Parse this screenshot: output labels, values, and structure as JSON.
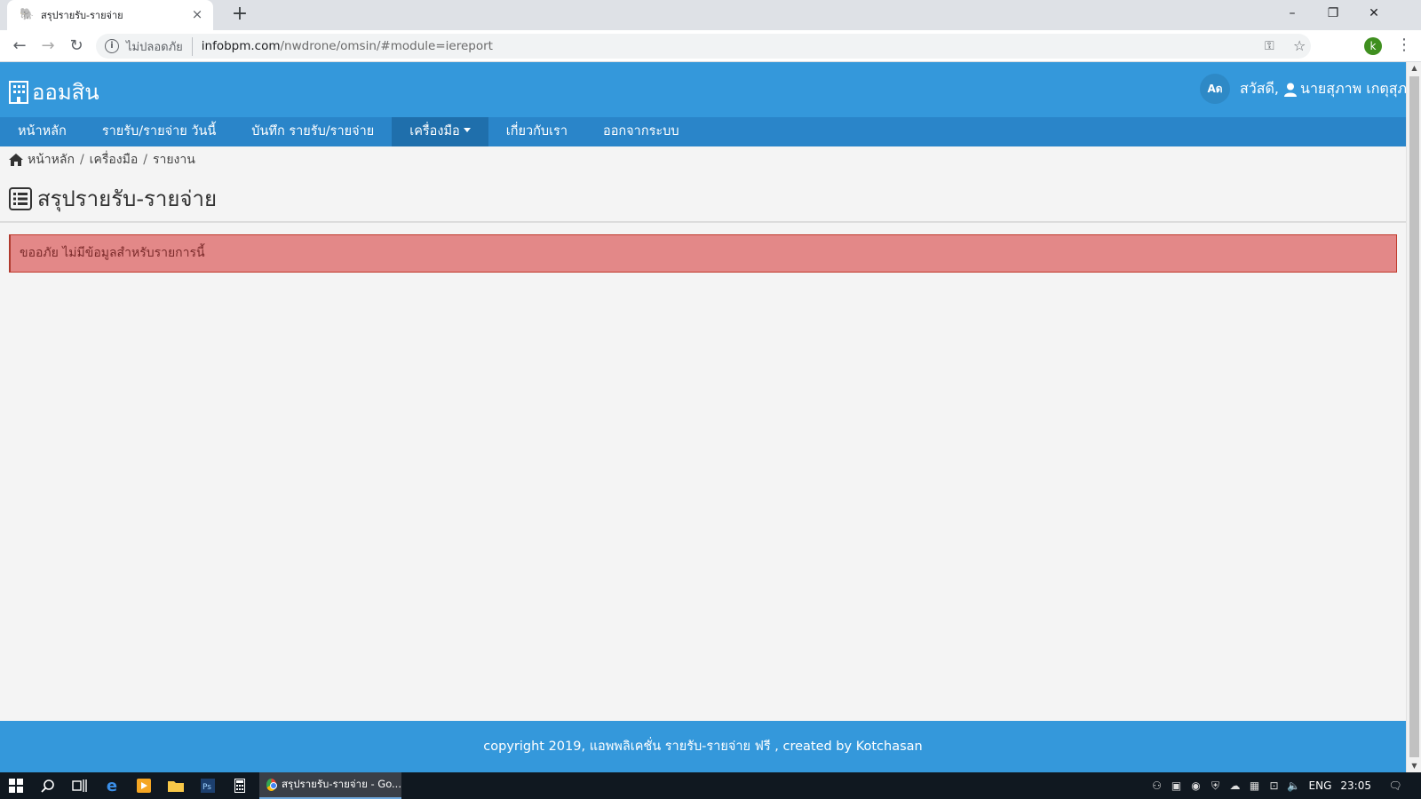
{
  "browser": {
    "tab_title": "สรุปรายรับ-รายจ่าย",
    "security_label": "ไม่ปลอดภัย",
    "url_host": "infobpm.com",
    "url_path": "/nwdrone/omsin/#module=iereport",
    "profile_initial": "k"
  },
  "header": {
    "logo_text": "ออมสิน",
    "lang_button": "Aด",
    "greeting": "สวัสดี,",
    "user_name": "นายสุภาพ เกตุสุภะ"
  },
  "nav": {
    "items": [
      {
        "label": "หน้าหลัก"
      },
      {
        "label": "รายรับ/รายจ่าย วันนี้"
      },
      {
        "label": "บันทึก รายรับ/รายจ่าย"
      },
      {
        "label": "เครื่องมือ"
      },
      {
        "label": "เกี่ยวกับเรา"
      },
      {
        "label": "ออกจากระบบ"
      }
    ]
  },
  "breadcrumb": {
    "items": [
      "หน้าหลัก",
      "เครื่องมือ",
      "รายงาน"
    ],
    "separator": "/"
  },
  "page": {
    "title": "สรุปรายรับ-รายจ่าย",
    "alert": "ขออภัย ไม่มีข้อมูลสำหรับรายการนี้"
  },
  "footer": {
    "text": "copyright 2019, แอพพลิเคชั่น รายรับ-รายจ่าย ฟรี , created by Kotchasan"
  },
  "taskbar": {
    "app_label": "สรุปรายรับ-รายจ่าย - Go...",
    "language": "ENG",
    "time": "23:05"
  },
  "colors": {
    "header": "#3498db",
    "navbar": "#2a85c9",
    "alert_bg": "#e38888"
  }
}
